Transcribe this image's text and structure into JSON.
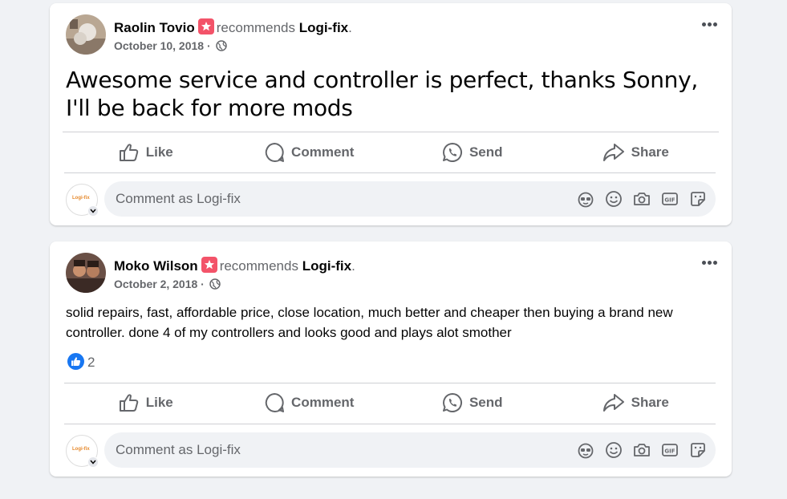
{
  "posts": [
    {
      "author": "Raolin Tovio",
      "recommends_text": "recommends",
      "page": "Logi-fix",
      "period": ".",
      "date": "October 10, 2018",
      "separator": "·",
      "text": "Awesome service and controller is perfect, thanks Sonny, I'll be back for more mods",
      "reactions": null
    },
    {
      "author": "Moko Wilson",
      "recommends_text": "recommends",
      "page": "Logi-fix",
      "period": ".",
      "date": "October 2, 2018",
      "separator": "·",
      "text": "solid repairs, fast, affordable price, close location, much better and cheaper then buying a brand new controller. done 4 of my controllers and looks good and plays alot smother",
      "reactions": {
        "like_count": "2"
      }
    }
  ],
  "actions": {
    "like": "Like",
    "comment": "Comment",
    "send": "Send",
    "share": "Share"
  },
  "comment_box": {
    "placeholder": "Comment as Logi-fix",
    "avatar_text": "Logi-fix",
    "icons": [
      "avatar-sticker-icon",
      "emoji-icon",
      "camera-icon",
      "gif-icon",
      "sticker-icon"
    ]
  },
  "colors": {
    "background": "#f0f2f5",
    "card": "#ffffff",
    "secondary_text": "#65676b",
    "recommend_badge": "#f35369",
    "like_blue": "#1877f2"
  }
}
